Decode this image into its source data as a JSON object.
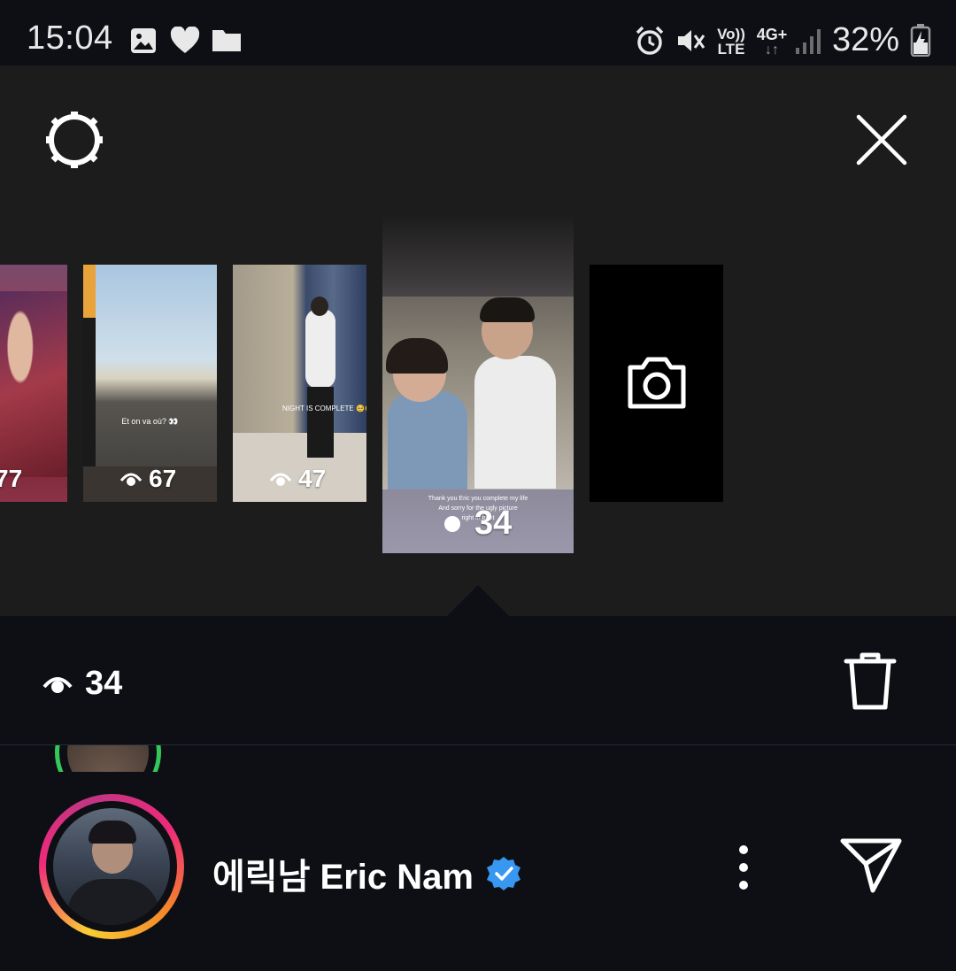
{
  "status_bar": {
    "time": "15:04",
    "battery": "32%",
    "network": "4G+",
    "volte_top": "Vo))",
    "volte_bottom": "LTE",
    "icons": [
      "gallery-icon",
      "heart-icon",
      "folder-icon",
      "alarm-icon",
      "mute-icon",
      "signal-icon",
      "battery-charging-icon"
    ]
  },
  "header": {
    "settings_icon": "gear-icon",
    "close_icon": "close-icon"
  },
  "stories": [
    {
      "views": "77",
      "caption": ""
    },
    {
      "views": "67",
      "caption": "Et on va où? 👀"
    },
    {
      "views": "47",
      "caption": "NIGHT IS COMPLETE 🥺🥺🥺"
    },
    {
      "views": "34",
      "caption_line1": "Thank you Eric you complete my life",
      "caption_line2": "And sorry for the ugly picture",
      "caption_line3": "right in front",
      "selected": true
    }
  ],
  "camera_tile": {
    "icon": "camera-icon"
  },
  "selected_story": {
    "views": "34"
  },
  "profile": {
    "name": "에릭남 Eric Nam",
    "verified": true
  },
  "colors": {
    "background": "#0d0f14",
    "panel": "#1c1c1c",
    "verified_blue": "#3897f0",
    "story_ring_start": "#f9ce34",
    "story_ring_end": "#ee2a7b",
    "close_friends_green": "#34c759"
  }
}
